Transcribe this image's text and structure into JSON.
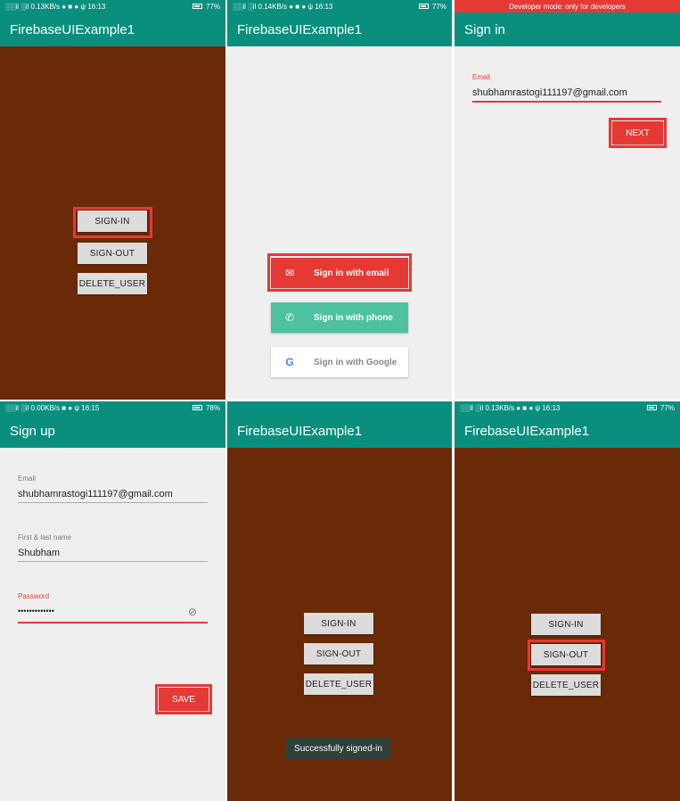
{
  "colors": {
    "appbar": "#0a8f7e",
    "brown": "#6b2a07",
    "accent_red": "#e53935",
    "phone_green": "#4dc1a0"
  },
  "screens": [
    {
      "status_left": "░░il ░il 0.13KB/s ● ■ ● ψ 16:13",
      "status_right": "77%",
      "title": "FirebaseUIExample1",
      "buttons": [
        "SIGN-IN",
        "SIGN-OUT",
        "DELETE_USER"
      ]
    },
    {
      "status_left": "░░il ░il 0.14KB/s ● ■ ● ψ 16:13",
      "status_right": "77%",
      "title": "FirebaseUIExample1",
      "providers": [
        {
          "label": "Sign in with email",
          "icon": "email-icon"
        },
        {
          "label": "Sign in with phone",
          "icon": "phone-icon"
        },
        {
          "label": "Sign in with Google",
          "icon": "google-icon"
        }
      ]
    },
    {
      "status_left": "Developer mode: only for developers",
      "title": "Sign in",
      "email_label": "Email",
      "email_value": "shubhamrastogi111197@gmail.com",
      "next_label": "NEXT"
    },
    {
      "status_left": "░░il ░il 0.00KB/s ■ ● ψ 16:15",
      "status_right": "78%",
      "title": "Sign up",
      "email_label": "Email",
      "email_value": "shubhamrastogi111197@gmail.com",
      "name_label": "First & last name",
      "name_value": "Shubham",
      "password_label": "Password",
      "password_value": "•••••••••••••",
      "save_label": "SAVE"
    },
    {
      "title": "FirebaseUIExample1",
      "buttons": [
        "SIGN-IN",
        "SIGN-OUT",
        "DELETE_USER"
      ],
      "toast": "Successfully signed-in"
    },
    {
      "status_left": "░░il ░il 0.13KB/s ● ■ ● ψ 16:13",
      "status_right": "77%",
      "title": "FirebaseUIExample1",
      "buttons": [
        "SIGN-IN",
        "SIGN-OUT",
        "DELETE_USER"
      ]
    }
  ]
}
